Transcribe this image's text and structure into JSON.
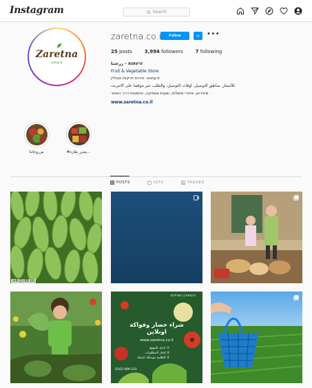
{
  "topbar": {
    "logo": "Instagram",
    "search_placeholder": "Search",
    "icons": [
      "home-icon",
      "direct-icon",
      "explore-icon",
      "heart-icon",
      "profile-icon"
    ]
  },
  "profile": {
    "username": "zaretna.co.il",
    "follow_label": "Follow",
    "posts_count": "25",
    "posts_label": "posts",
    "followers_count": "3,994",
    "followers_label": "followers",
    "following_count": "7",
    "following_label": "following",
    "full_name": "זרעתנא - زرعتنا",
    "category": "Fruit & Vegetable Store",
    "bio_1": "זרעתנא- פירות וירקות אונליין",
    "bio_2": "للأسعار، مناطق التوصيل، اوقات التوصيل، والطلب عبر موقعنا على الانترنت.",
    "bio_3": "מחירים, איזורי משלוח, שעות אספקה, והזמנות דרך האתר",
    "website": "www.zaretna.co.il",
    "avatar_logo": "Zaretna",
    "avatar_sub": "זרעתנא"
  },
  "highlights": [
    {
      "label": "مزروعاتنا"
    },
    {
      "label": "#يعني_طازة..."
    }
  ],
  "tabs": [
    {
      "label": "POSTS",
      "active": true
    },
    {
      "label": "IGTV",
      "active": false
    },
    {
      "label": "TAGGED",
      "active": false
    }
  ],
  "posts": {
    "p1_caption": "+4 (1) 85 00",
    "p5_top": "זרעתנא | בשבילכם",
    "p5_title_1": "شراء خضار وفواكة",
    "p5_title_2": "اونلاين",
    "p5_url": "www.zaretna.co.il",
    "p5_b1": "ادخل للموقع ①",
    "p5_b2": "إختار المطلوبات ②",
    "p5_b3": "الطلبية بتوصلك لبابيتك ③",
    "p5_phone": "0542-999-331"
  },
  "colors": {
    "accent": "#0095f6",
    "link": "#00376b",
    "border": "#dbdbdb",
    "muted": "#8e8e8e"
  }
}
